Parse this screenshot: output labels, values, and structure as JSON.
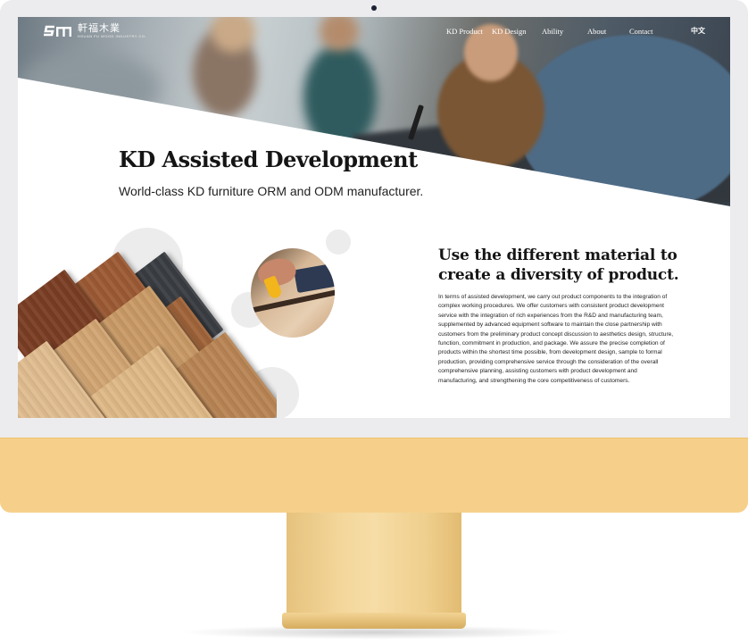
{
  "site": {
    "logo_text": "軒福木業",
    "logo_subtext": "HSUAN FU WOOD INDUSTRY CO.",
    "nav": [
      {
        "label": "KD Product"
      },
      {
        "label": "KD Design"
      },
      {
        "label": "Ability"
      },
      {
        "label": "About"
      },
      {
        "label": "Contact"
      }
    ],
    "language_toggle": "中文"
  },
  "hero": {
    "title": "KD Assisted Development",
    "subtitle": "World-class KD furniture ORM and ODM manufacturer."
  },
  "section": {
    "heading": "Use the different material to create a diversity of product.",
    "body": "In terms of assisted development, we carry out product components to the integration of complex working procedures. We offer customers with consistent product development service with the integration of rich experiences from the R&D and manufacturing team, supplemented by advanced equipment software to maintain the close partnership with customers from the preliminary product concept discussion to aesthetics design, structure, function, commitment in production, and package. We assure the precise completion of products within the shortest time possible, from development design, sample to formal production, providing comprehensive service through the consideration of the overall comprehensive planning, assisting customers with product development and manufacturing, and strengthening the core competitiveness of customers."
  },
  "colors": {
    "monitor_chin": "#f6d08a",
    "bezel": "#ececee",
    "heading": "#151515"
  }
}
